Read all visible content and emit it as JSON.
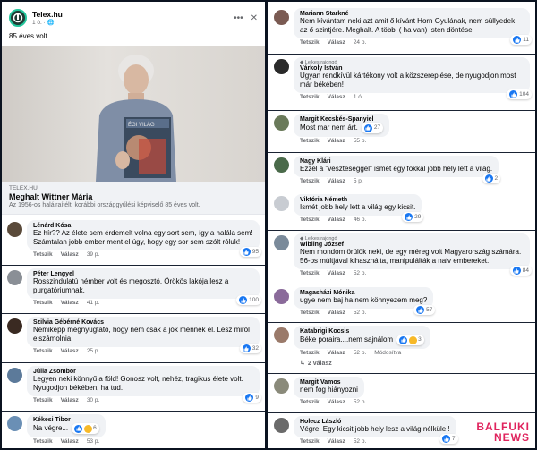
{
  "post": {
    "page_name": "Telex.hu",
    "time": "1 ó. · ",
    "text": "85 éves volt.",
    "link": {
      "domain": "TELEX.HU",
      "title": "Meghalt Wittner Mária",
      "description": "Az 1956-os halálraítélt, korábbi országgyűlési képviselő 85 éves volt."
    },
    "book_cover_text": "ÉGI VILÁG"
  },
  "labels": {
    "like": "Tetszik",
    "reply": "Válasz",
    "fan_badge": "Lelkes rajongó",
    "edited": "Módosítva"
  },
  "left_comments": [
    {
      "name": "Lénárd Kósa",
      "text": "Ez hír?? Az élete sem érdemelt volna egy sort sem, így a halála sem! Számtalan jobb ember ment el úgy, hogy egy sor sem szólt róluk!",
      "time": "39 p.",
      "likes": "95",
      "avatar_color": "#5a4a3a"
    },
    {
      "name": "Péter Lengyel",
      "text": "Rosszindulatú némber volt és megosztó. Örökös lakója lesz a purgatóriumnak.",
      "time": "41 p.",
      "likes": "100",
      "avatar_color": "#8a8f96"
    },
    {
      "name": "Szilvia Gébérné Kovács",
      "text": "Némiképp megnyugtató, hogy nem csak a jók mennek el. Lesz miről elszámolnia.",
      "time": "25 p.",
      "likes": "32",
      "avatar_color": "#3a2a22"
    },
    {
      "name": "Júlia Zsombor",
      "text": "Legyen neki könnyű a föld! Gonosz volt, nehéz, tragikus élete volt. Nyugodjon békében, ha tud.",
      "time": "30 p.",
      "likes": "9",
      "avatar_color": "#5c7a9a"
    },
    {
      "name": "Kékesi Tibor",
      "text": "Na végre...",
      "time": "53 p.",
      "likes": "6",
      "avatar_color": "#6a8fb5"
    }
  ],
  "right_comments": [
    {
      "name": "Mariann Starkné",
      "text": "Nem kívántam neki azt amit ő kívánt Horn Gyulának, nem süllyedek az ő szintjére. Meghalt. A többi ( ha van) Isten döntése.",
      "time": "24 p.",
      "likes": "11",
      "avatar_color": "#7a5a52"
    },
    {
      "name": "Várkoly István",
      "text": "Ugyan rendkívül kártékony volt a közszereplése, de nyugodjon most már békében!",
      "time": "1 ó.",
      "likes": "104",
      "avatar_color": "#2a2a2a",
      "fan": true
    },
    {
      "name": "Margit Kecskés-Spanyiel",
      "text": "Most mar nem árt.",
      "time": "55 p.",
      "likes": "27",
      "avatar_color": "#6a7a5a"
    },
    {
      "name": "Nagy Klári",
      "text": "Ezzel a \"veszteséggel\" ismét egy fokkal jobb hely lett a világ.",
      "time": "5 p.",
      "likes": "2",
      "avatar_color": "#4a6a4a"
    },
    {
      "name": "Viktória Németh",
      "text": "Ismét jobb hely lett a világ egy kicsit.",
      "time": "46 p.",
      "likes": "29",
      "avatar_color": "#c8ccd2"
    },
    {
      "name": "Wibling József",
      "text": "Nem mondom örülök neki, de egy méreg volt Magyarország számára. 56-os múltjával kihasználta, manipulálták a naiv embereket.",
      "time": "52 p.",
      "likes": "84",
      "avatar_color": "#7a8a9a",
      "fan": true
    },
    {
      "name": "Magasházi Mónika",
      "text": "ugye nem baj ha nem könnyezem meg?",
      "time": "52 p.",
      "likes": "57",
      "avatar_color": "#8a6a9a"
    },
    {
      "name": "Katabrigi Kocsis",
      "text": "Béke poraira....nem sajnálom",
      "time": "52 p.",
      "likes": "3",
      "avatar_color": "#9a7a6a",
      "edited": true,
      "replies": "2 válasz"
    },
    {
      "name": "Margit Vamos",
      "text": "nem fog hiányozni",
      "time": "52 p.",
      "likes": "",
      "avatar_color": "#8a8a7a"
    },
    {
      "name": "Holecz László",
      "text": "Végre! Egy kicsit jobb hely lesz a világ nélküle !",
      "time": "52 p.",
      "likes": "7",
      "avatar_color": "#6a6a6a"
    }
  ],
  "watermark": {
    "line1": "BALFUKI",
    "line2": "NEWS"
  }
}
